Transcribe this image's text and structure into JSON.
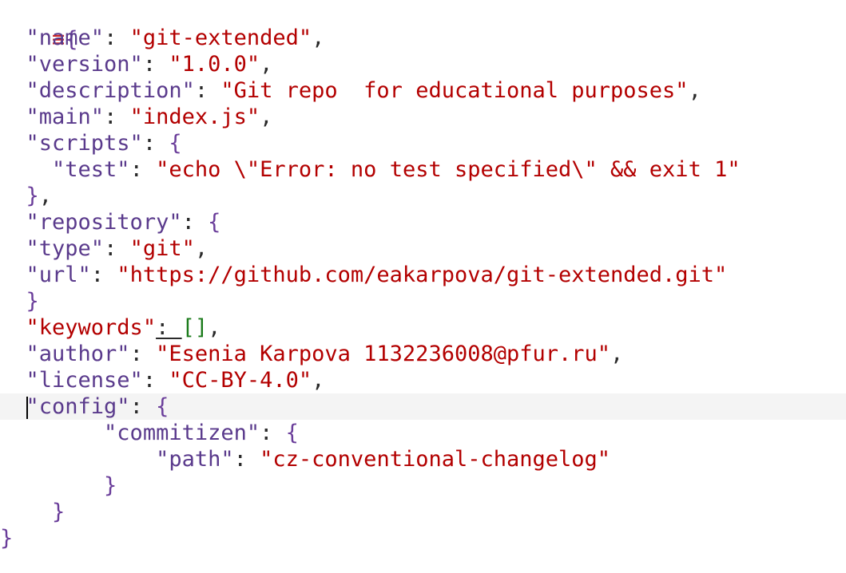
{
  "editor": {
    "fold_marker": "≡",
    "lines": {
      "l1_open": "{",
      "name_key": "\"name\"",
      "name_val": "\"git-extended\"",
      "version_key": "\"version\"",
      "version_val": "\"1.0.0\"",
      "description_key": "\"description\"",
      "description_val": "\"Git repo  for educational purposes\"",
      "main_key": "\"main\"",
      "main_val": "\"index.js\"",
      "scripts_key": "\"scripts\"",
      "test_key": "\"test\"",
      "test_val": "\"echo \\\"Error: no test specified\\\" && exit 1\"",
      "repository_key": "\"repository\"",
      "type_key": "\"type\"",
      "type_val": "\"git\"",
      "url_key": "\"url\"",
      "url_val": "\"https://github.com/eakarpova/git-extended.git\"",
      "keywords_key": "\"keywords\"",
      "keywords_val": "[]",
      "author_key": "\"author\"",
      "author_val": "\"Esenia Karpova 1132236008@pfur.ru\"",
      "license_key": "\"license\"",
      "license_val": "\"CC-BY-4.0\"",
      "config_key": "\"config\"",
      "commitizen_key": "\"commitizen\"",
      "path_key": "\"path\"",
      "path_val": "\"cz-conventional-changelog\"",
      "close_brace": "}"
    },
    "colors": {
      "key": "#5a3a8c",
      "string": "#b30000",
      "bracket": "#6a3d9a",
      "array": "#1a7a1a"
    }
  }
}
